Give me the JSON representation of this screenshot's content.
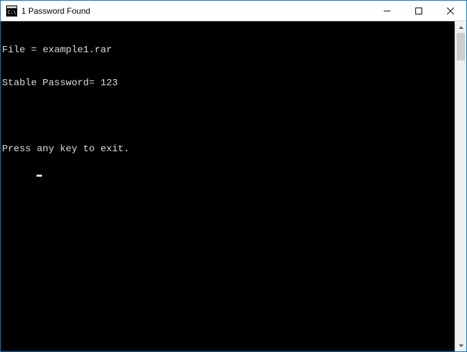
{
  "titlebar": {
    "title": "1 Password Found"
  },
  "console": {
    "line1_prefix": "File = ",
    "file_name": "example1.rar",
    "line2_prefix": "Stable Password= ",
    "password": "123",
    "blank_line": " ",
    "exit_prompt": "Press any key to exit."
  }
}
